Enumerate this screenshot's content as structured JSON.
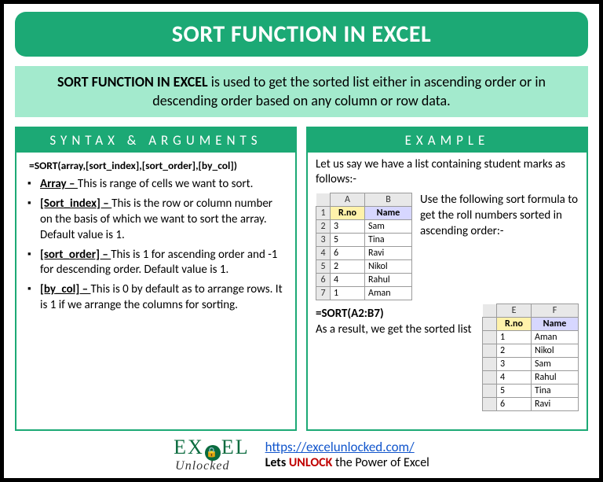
{
  "title": "SORT FUNCTION IN EXCEL",
  "description": {
    "strong": "SORT FUNCTION IN EXCEL",
    "rest": " is used to get the sorted list either in ascending order or in descending order based on any column or row data."
  },
  "syntax": {
    "header": "SYNTAX & ARGUMENTS",
    "formula": "=SORT(array,[sort_index],[sort_order],[by_col])",
    "args": [
      {
        "name": "Array – ",
        "desc": "This is range of cells we want to sort."
      },
      {
        "name": "[Sort_index] – ",
        "desc": "This is the row or column number on the basis of which we want to sort the array. Default value is 1."
      },
      {
        "name": "[sort_order] – ",
        "desc": "This is 1 for ascending order and -1 for descending order. Default value is 1."
      },
      {
        "name": "[by_col] – ",
        "desc": "This is 0 by default as to arrange rows. It is 1 if we arrange the columns for sorting."
      }
    ]
  },
  "example": {
    "header": "EXAMPLE",
    "intro": "Let us say we have a list containing student marks as follows:-",
    "use_text": "Use the following sort formula to get the roll numbers sorted in ascending order:-",
    "formula": "=SORT(A2:B7)",
    "result_text": "As a result, we get the sorted list",
    "input_table": {
      "cols": [
        "A",
        "B"
      ],
      "header_row": [
        "R.no",
        "Name"
      ],
      "rows": [
        [
          "3",
          "Sam"
        ],
        [
          "5",
          "Tina"
        ],
        [
          "6",
          "Ravi"
        ],
        [
          "2",
          "Nikol"
        ],
        [
          "4",
          "Rahul"
        ],
        [
          "1",
          "Aman"
        ]
      ]
    },
    "output_table": {
      "cols": [
        "E",
        "F"
      ],
      "header_row": [
        "R.no",
        "Name"
      ],
      "rows": [
        [
          "1",
          "Aman"
        ],
        [
          "2",
          "Nikol"
        ],
        [
          "3",
          "Sam"
        ],
        [
          "4",
          "Rahul"
        ],
        [
          "5",
          "Tina"
        ],
        [
          "6",
          "Ravi"
        ]
      ]
    }
  },
  "footer": {
    "logo_main": "EXCEL",
    "logo_sub": "Unlocked",
    "url": "https://excelunlocked.com/",
    "tagline_lets": "Lets ",
    "tagline_unlock": "UNLOCK",
    "tagline_rest": " the Power of Excel"
  }
}
